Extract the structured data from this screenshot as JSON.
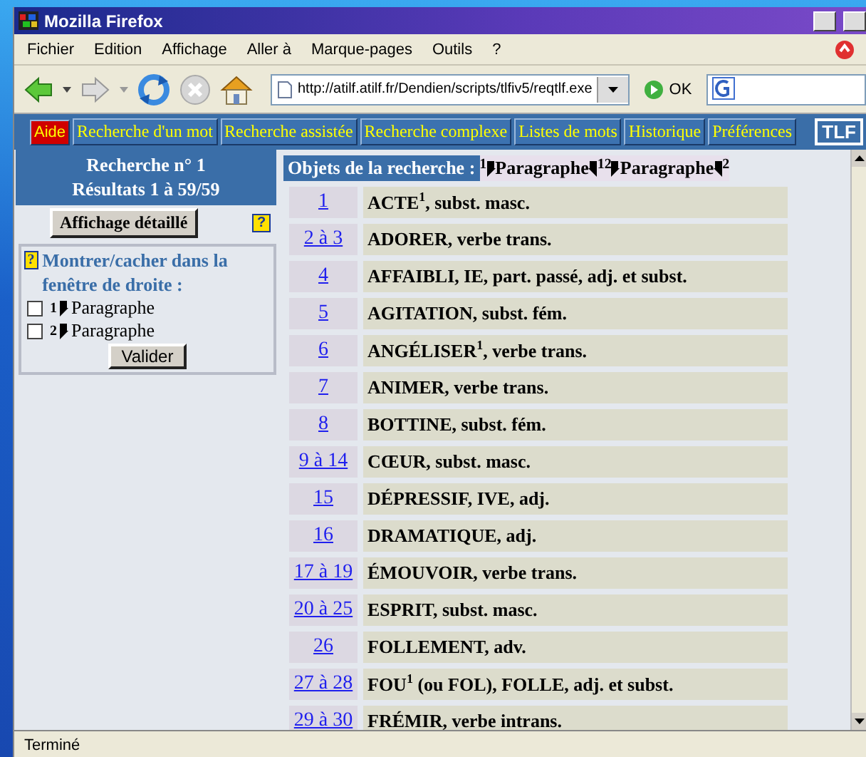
{
  "window": {
    "title": "Mozilla Firefox"
  },
  "menu": [
    "Fichier",
    "Edition",
    "Affichage",
    "Aller à",
    "Marque-pages",
    "Outils",
    "?"
  ],
  "toolbar": {
    "url": "http://atilf.atilf.fr/Dendien/scripts/tlfiv5/reqtlf.exe",
    "go_label": "OK"
  },
  "site_nav": [
    {
      "label": "Aide",
      "kind": "help"
    },
    {
      "label": "Recherche d'un mot",
      "kind": "link"
    },
    {
      "label": "Recherche assistée",
      "kind": "link"
    },
    {
      "label": "Recherche complexe",
      "kind": "link"
    },
    {
      "label": "Listes de mots",
      "kind": "link"
    },
    {
      "label": "Historique",
      "kind": "link"
    },
    {
      "label": "Préférences",
      "kind": "link"
    }
  ],
  "site_logo": "TLF",
  "sidebar": {
    "search_title": "Recherche n° 1",
    "results": "Résultats 1 à 59/59",
    "detail_button": "Affichage détaillé",
    "help_mark": "?",
    "toggle_title": "Montrer/cacher dans la fenêtre de droite :",
    "options": [
      {
        "number": "1",
        "label": "Paragraphe",
        "checked": false
      },
      {
        "number": "2",
        "label": "Paragraphe",
        "checked": false
      }
    ],
    "submit": "Valider"
  },
  "results": {
    "heading": "Objets de la recherche :",
    "objects": [
      {
        "open": "1",
        "label": "Paragraphe",
        "close": "1"
      },
      {
        "open": "2",
        "label": "Paragraphe",
        "close": "2"
      }
    ],
    "rows": [
      {
        "range": "1",
        "entry": "ACTE$^{1}$, subst. masc."
      },
      {
        "range": "2 à 3",
        "entry": "ADORER, verbe trans."
      },
      {
        "range": "4",
        "entry": "AFFAIBLI, IE, part. passé, adj. et subst."
      },
      {
        "range": "5",
        "entry": "AGITATION, subst. fém."
      },
      {
        "range": "6",
        "entry": "ANGÉLISER$^{1}$, verbe trans."
      },
      {
        "range": "7",
        "entry": "ANIMER, verbe trans."
      },
      {
        "range": "8",
        "entry": "BOTTINE, subst. fém."
      },
      {
        "range": "9 à 14",
        "entry": "CŒUR, subst. masc."
      },
      {
        "range": "15",
        "entry": "DÉPRESSIF, IVE, adj."
      },
      {
        "range": "16",
        "entry": "DRAMATIQUE, adj."
      },
      {
        "range": "17 à 19",
        "entry": "ÉMOUVOIR, verbe trans."
      },
      {
        "range": "20 à 25",
        "entry": "ESPRIT, subst. masc."
      },
      {
        "range": "26",
        "entry": "FOLLEMENT, adv."
      },
      {
        "range": "27 à 28",
        "entry": "FOU$^{1}$ (ou FOL), FOLLE, adj. et subst."
      },
      {
        "range": "29 à 30",
        "entry": "FRÉMIR, verbe intrans."
      }
    ]
  },
  "status_bar": "Terminé"
}
